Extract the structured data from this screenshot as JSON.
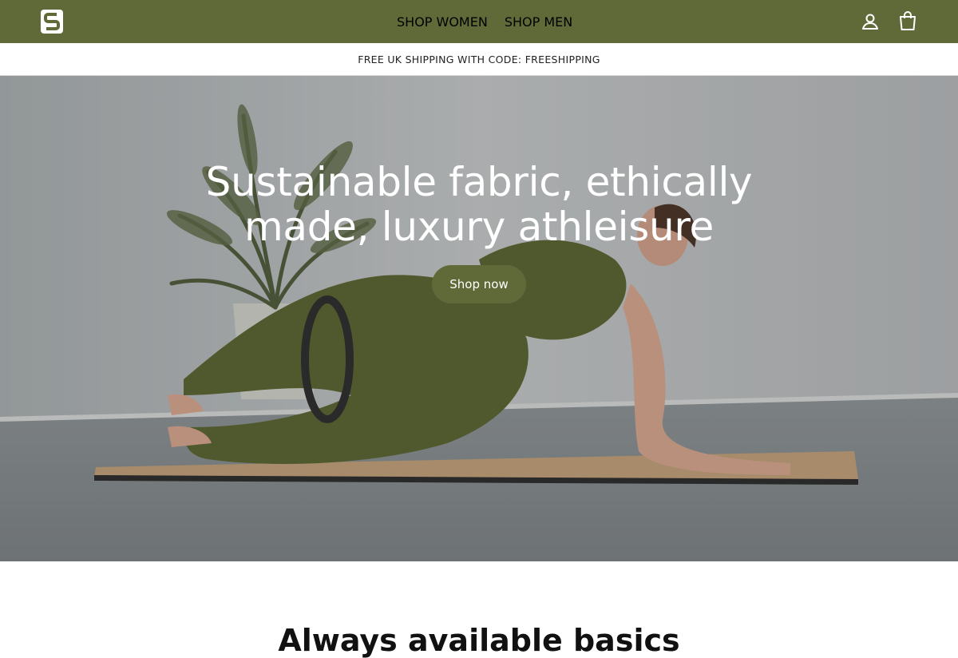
{
  "header": {
    "brand_color": "#606a38",
    "logo_icon": "s-logo-icon",
    "nav": [
      {
        "label": "SHOP WOMEN"
      },
      {
        "label": "SHOP MEN"
      }
    ],
    "account_icon": "account-icon",
    "bag_icon": "shopping-bag-icon"
  },
  "announcement": {
    "text": "FREE UK SHIPPING WITH CODE: FREESHIPPING"
  },
  "hero": {
    "title": "Sustainable fabric, ethically made, luxury athleisure",
    "button_label": "Shop now"
  },
  "next_section": {
    "title": "Always available basics"
  }
}
